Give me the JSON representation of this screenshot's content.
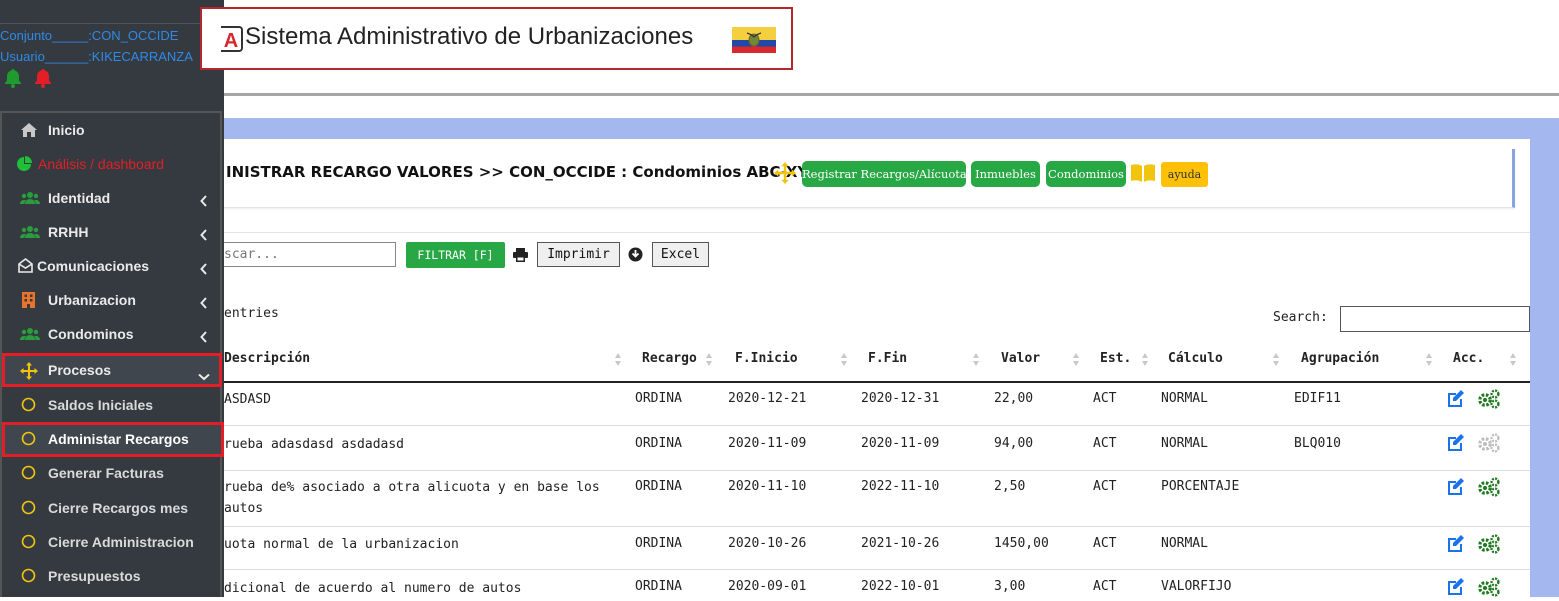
{
  "header": {
    "logo_letter": "A",
    "title": "Sistema Administrativo de Urbanizaciones",
    "flag_colors": [
      "#f4d03f",
      "#1f4aa8",
      "#d7282d"
    ]
  },
  "sidebar": {
    "conjunto": "Conjunto_____:CON_OCCIDE",
    "usuario": "Usuario______:KIKECARRANZA",
    "bell_colors": [
      "#1e9c2f",
      "#e41e26"
    ],
    "items": [
      {
        "label": "Inicio",
        "icon": "home-icon"
      },
      {
        "label": "Análisis / dashboard",
        "icon": "pie-chart-icon",
        "color": "#e41e26"
      },
      {
        "label": "Identidad",
        "icon": "users-icon"
      },
      {
        "label": "RRHH",
        "icon": "users-icon"
      },
      {
        "label": "Comunicaciones",
        "icon": "envelope-open-icon"
      },
      {
        "label": "Urbanizacion",
        "icon": "building-icon"
      },
      {
        "label": "Condominos",
        "icon": "users-icon"
      },
      {
        "label": "Procesos",
        "icon": "arrows-move-icon"
      },
      {
        "label": "Saldos Iniciales",
        "icon": "circle-icon"
      },
      {
        "label": "Administar Recargos",
        "icon": "circle-icon"
      },
      {
        "label": "Generar Facturas",
        "icon": "circle-icon"
      },
      {
        "label": "Cierre Recargos mes",
        "icon": "circle-icon"
      },
      {
        "label": "Cierre Administracion",
        "icon": "circle-icon"
      },
      {
        "label": "Presupuestos",
        "icon": "circle-icon"
      }
    ]
  },
  "panel": {
    "heading": "INISTRAR RECARGO VALORES >> CON_OCCIDE : Condominios ABC-XYZ.",
    "btn_registrar": "Registrar Recargos/Alícuotas",
    "btn_inmuebles": "Inmuebles",
    "btn_condominios": "Condominios",
    "btn_ayuda": "ayuda"
  },
  "filter": {
    "search_placeholder": "scar...",
    "btn_filtrar": "FILTRAR [F]",
    "btn_imprimir": "Imprimir",
    "btn_excel": "Excel"
  },
  "table": {
    "entries_label": "entries",
    "search_label": "Search:",
    "columns": [
      "Descripción",
      "Recargo",
      "F.Inicio",
      "F.Fin",
      "Valor",
      "Est.",
      "Cálculo",
      "Agrupación",
      "Acc."
    ],
    "rows": [
      {
        "desc": "ASDASD",
        "recargo": "ORDINA",
        "inicio": "2020-12-21",
        "fin": "2020-12-31",
        "valor": "22,00",
        "est": "ACT",
        "calculo": "NORMAL",
        "agrupacion": "EDIF11",
        "gear_enabled": true
      },
      {
        "desc": "rueba adasdasd asdadasd",
        "recargo": "ORDINA",
        "inicio": "2020-11-09",
        "fin": "2020-11-09",
        "valor": "94,00",
        "est": "ACT",
        "calculo": "NORMAL",
        "agrupacion": "BLQ010",
        "gear_enabled": false
      },
      {
        "desc": "rueba de% asociado a otra alicuota y en base los autos",
        "recargo": "ORDINA",
        "inicio": "2020-11-10",
        "fin": "2022-11-10",
        "valor": "2,50",
        "est": "ACT",
        "calculo": "PORCENTAJE",
        "agrupacion": "",
        "gear_enabled": true
      },
      {
        "desc": "uota normal de la urbanizacion",
        "recargo": "ORDINA",
        "inicio": "2020-10-26",
        "fin": "2021-10-26",
        "valor": "1450,00",
        "est": "ACT",
        "calculo": "NORMAL",
        "agrupacion": "",
        "gear_enabled": true
      },
      {
        "desc": "dicional de acuerdo al numero de autos",
        "recargo": "ORDINA",
        "inicio": "2020-09-01",
        "fin": "2022-10-01",
        "valor": "3,00",
        "est": "ACT",
        "calculo": "VALORFIJO",
        "agrupacion": "",
        "gear_enabled": true
      }
    ]
  }
}
